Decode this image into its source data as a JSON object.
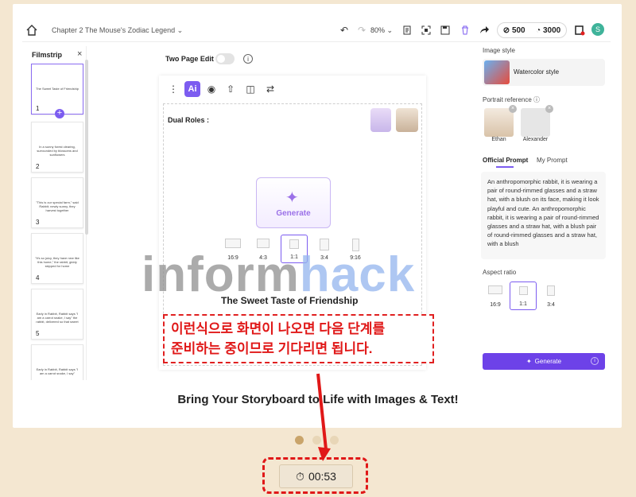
{
  "topbar": {
    "breadcrumb": "Chapter 2  The Mouse's Zodiac Legend",
    "zoom": "80%",
    "credit_a": "500",
    "credit_b": "3000",
    "avatar_initial": "S"
  },
  "filmstrip": {
    "title": "Filmstrip",
    "close": "×",
    "add": "+",
    "pages": [
      {
        "text": "The Sweet Taste of Friendship",
        "num": "1"
      },
      {
        "text": "In a sunny forest clearing, surrounded by blossoms and sunflowers",
        "num": "2"
      },
      {
        "text": "\"This is our special farm,\" said Rabbit; newly sunny, they harvest together",
        "num": "3"
      },
      {
        "text": "\"It's so juicy, they have new like this home,\" the rabbit, giddy skipped for home",
        "num": "4"
      },
      {
        "text": "Early in Rabbit, Rabbit says \"I am a carrot snake, I say\" the rabbit, delivered so that sweet",
        "num": "5"
      },
      {
        "text": "Early in Rabbit, Rabbit says \"I am a carrot snake, I say\"",
        "num": "6"
      }
    ]
  },
  "editor": {
    "two_page_label": "Two Page Edit",
    "info": "i",
    "ai_label": "Ai",
    "dual_roles": "Dual Roles :",
    "generate": "Generate",
    "ratios": [
      "16:9",
      "4:3",
      "1:1",
      "3:4",
      "9:16"
    ],
    "story_title": "The Sweet Taste of Friendship"
  },
  "watermark": {
    "part1": "inform",
    "part2": "hack"
  },
  "note": {
    "line1": "이런식으로 화면이 나오면 다음 단계를",
    "line2": "준비하는 중이므로 기다리면 됩니다."
  },
  "headline": "Bring Your Storyboard to Life with Images & Text!",
  "timer": "00:53",
  "right_panel": {
    "image_style_label": "Image style",
    "style_name": "Watercolor style",
    "portrait_label": "Portrait reference",
    "portraits": [
      {
        "name": "Ethan"
      },
      {
        "name": "Alexander"
      }
    ],
    "tab_official": "Official Prompt",
    "tab_mine": "My Prompt",
    "prompt_text": "An anthropomorphic rabbit, it is wearing a pair of round-rimmed glasses and a straw hat, with a blush on its face, making it look playful and cute. An anthropomorphic rabbit, it is wearing a pair of round-rimmed glasses and a straw hat, with a blush pair of round-rimmed glasses and a straw hat, with a blush",
    "aspect_label": "Aspect ratio",
    "aspect_options": [
      "16:9",
      "1:1",
      "3:4"
    ],
    "generate_button": "Generate"
  },
  "colors": {
    "accent": "#7c5cf0",
    "annotation": "#e01818",
    "page_bg": "#f4e7d1"
  }
}
